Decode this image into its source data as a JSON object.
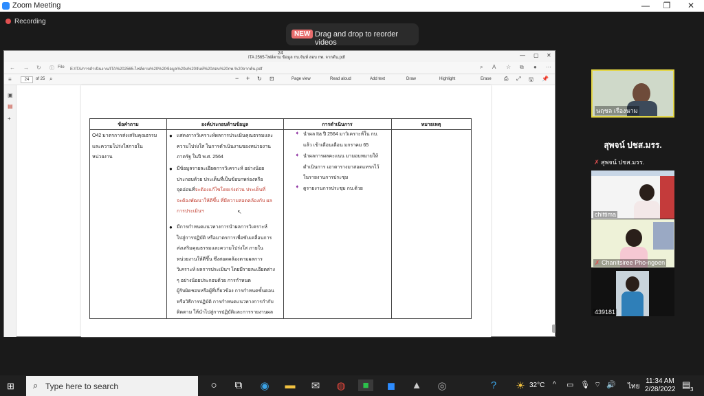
{
  "zoom": {
    "title": "Zoom Meeting",
    "recording": "Recording",
    "toast_badge": "NEW",
    "toast_text": "Drag and drop to reorder videos"
  },
  "pdf": {
    "window_title": "ITA 2565-ไฟล์ตาม ข้อมูล กบ.จันท์ สอบ กพ. จากต้น.pdf",
    "address_label": "File",
    "url": "E:/ITA/การดำเนินงาน/ITA%202565-ไฟล์ตาม%20%20ข้อมูล%20ผ%20จันท์%20สอบ%20กพ.%20จากต้น.pdf",
    "page_current": "24",
    "page_total": "of 25",
    "tools": [
      "Page view",
      "Read aloud",
      "Add text",
      "Draw",
      "Highlight",
      "Erase"
    ],
    "page_number": "24"
  },
  "table": {
    "headers": [
      "ข้อคำถาม",
      "องค์ประกอบด้านข้อมูล",
      "การดำเนินการ",
      "หมายเหตุ"
    ],
    "question": [
      "O42 มาตรการส่งเสริมคุณธรรม",
      "และความโปร่งใสภายใน",
      "หน่วยงาน"
    ],
    "components_1": [
      "แสดงการวิเคราะห์ผลการประเมินคุณธรรมและ",
      "ความโปร่งใส ในการดำเนินงานของหน่วยงาน",
      "ภาครัฐ ในปี พ.ศ. 2564"
    ],
    "components_2": [
      "มีข้อมูลรายละเอียดการวิเคราะห์ อย่างน้อย",
      "ประกอบด้วย ประเด็นที่เป็นข้อบกพร่องหรือ"
    ],
    "components_2_mixed": {
      "plain": "จุดอ่อนที่",
      "red": "จะต้องแก้ไขโดยเร่งด่วน ประเด็นที่"
    },
    "components_2_red": [
      "จะต้องพัฒนาให้ดีขึ้น ที่มีความสอดคล้องกับ ผล",
      "การประเมินฯ"
    ],
    "components_3": [
      "มีการกำหนดแนวทางการนำผลการวิเคราะห์",
      "ไปสู่การปฏิบัติ หรือมาตรการเพื่อขับเคลื่อนการ",
      "ส่งเสริมคุณธรรมและความโปร่งใส ภายใน",
      "หน่วยงานให้ดีขึ้น ซึ่งสอดคล้องตามผลการ",
      "วิเคราะห์ ผลการประเมินฯ โดยมีรายละเอียดต่าง",
      "ๆ อย่างน้อยประกอบด้วย การกำหนด",
      "ผู้รับผิดชอบหรือผู้ที่เกี่ยวข้อง การกำหนดขั้นตอน",
      "หรือวิธีการปฏิบัติ การกำหนดแนวทางการกำกับ",
      "ติดตาม ให้นำไปสู่การปฏิบัติและการรายงานผล"
    ],
    "actions_1": [
      "นำผล Ita ปี 2564 มาวิเคราะห์ใน กบ.",
      "แล้ว เข้าเดือนเดือน มกราคม 65"
    ],
    "actions_2": [
      "นำผลการผลคะแนน มามอบหมายให้",
      "ดำเนินการ เอาตารางมาสอดแทรกไว้",
      "ในรายงานการประชุม"
    ],
    "actions_3": [
      "ดูรายงานการประชุม กบ.ด้วย"
    ]
  },
  "participants": {
    "p1": "นฤชล เรืองนาม",
    "p2_big": "สุพจน์ ปชส.มรร.",
    "p2": "สุพจน์ ปชส.มรร.",
    "p3": "chittima",
    "p4": "Chanitsiree Pho-ngoen",
    "p5": "439181"
  },
  "taskbar": {
    "search_placeholder": "Type here to search",
    "temperature": "32°C",
    "lang": "ไทย",
    "time": "11:34 AM",
    "date": "2/28/2022",
    "notifications": "3"
  }
}
